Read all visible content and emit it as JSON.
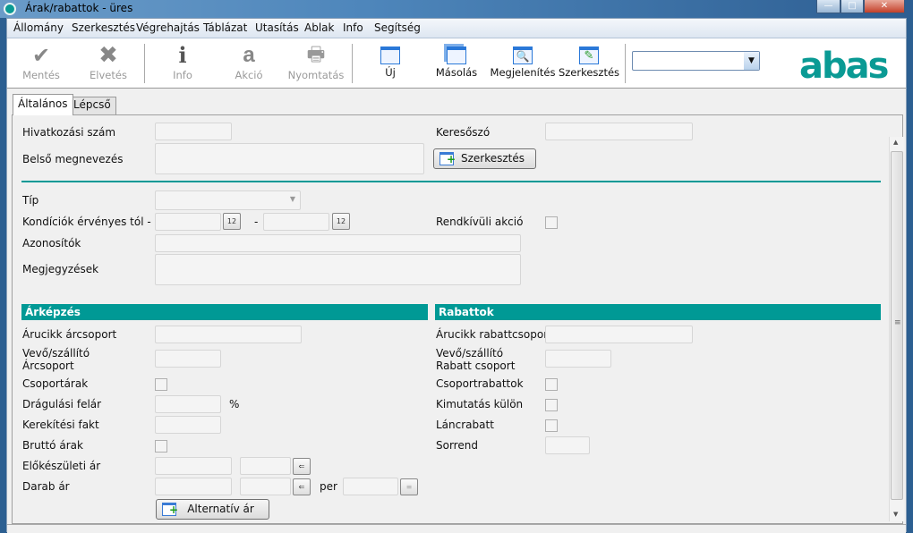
{
  "window": {
    "title": "Árak/rabattok - üres",
    "minimize": "—",
    "maximize": "□",
    "close": "✕"
  },
  "menu": [
    "Állomány",
    "Szerkesztés",
    "Végrehajtás",
    "Táblázat",
    "Utasítás",
    "Ablak",
    "Info",
    "Segítség"
  ],
  "toolbar": {
    "save": "Mentés",
    "discard": "Elvetés",
    "info": "Info",
    "action": "Akció",
    "print": "Nyomtatás",
    "new": "Új",
    "copy": "Másolás",
    "view": "Megjelenítés",
    "edit": "Szerkesztés",
    "combo_value": "",
    "logo": "abas"
  },
  "tabs": [
    "Általános",
    "Lépcső"
  ],
  "form": {
    "ref_no": "Hivatkozási szám",
    "keyword": "Keresőszó",
    "internal_name": "Belső megnevezés",
    "edit_button": "Szerkesztés",
    "type": "Típ",
    "valid": "Kondíciók érvényes tól - ig",
    "dash": "-",
    "special_action": "Rendkívüli akció",
    "ids": "Azonosítók",
    "notes": "Megjegyzések"
  },
  "pricing": {
    "header": "Árképzés",
    "item_group": "Árucikk árcsoport",
    "cust_group_1": "Vevő/szállító",
    "cust_group_2": "Árcsoport",
    "group_prices": "Csoportárak",
    "markup": "Drágulási felár",
    "percent": "%",
    "rounding": "Kerekítési fakt",
    "gross": "Bruttó árak",
    "prep_price": "Előkészületi ár",
    "unit_price": "Darab ár",
    "per": "per",
    "alt_price_button": "Alternatív ár"
  },
  "discounts": {
    "header": "Rabattok",
    "item_group": "Árucikk rabattcsoport",
    "cust_group_1": "Vevő/szállító",
    "cust_group_2": "Rabatt csoport",
    "group_discounts": "Csoportrabattok",
    "separate": "Kimutatás külön",
    "chain": "Láncrabatt",
    "order": "Sorrend"
  },
  "colors": {
    "accent": "#009995",
    "logo": "#0a9a94"
  }
}
